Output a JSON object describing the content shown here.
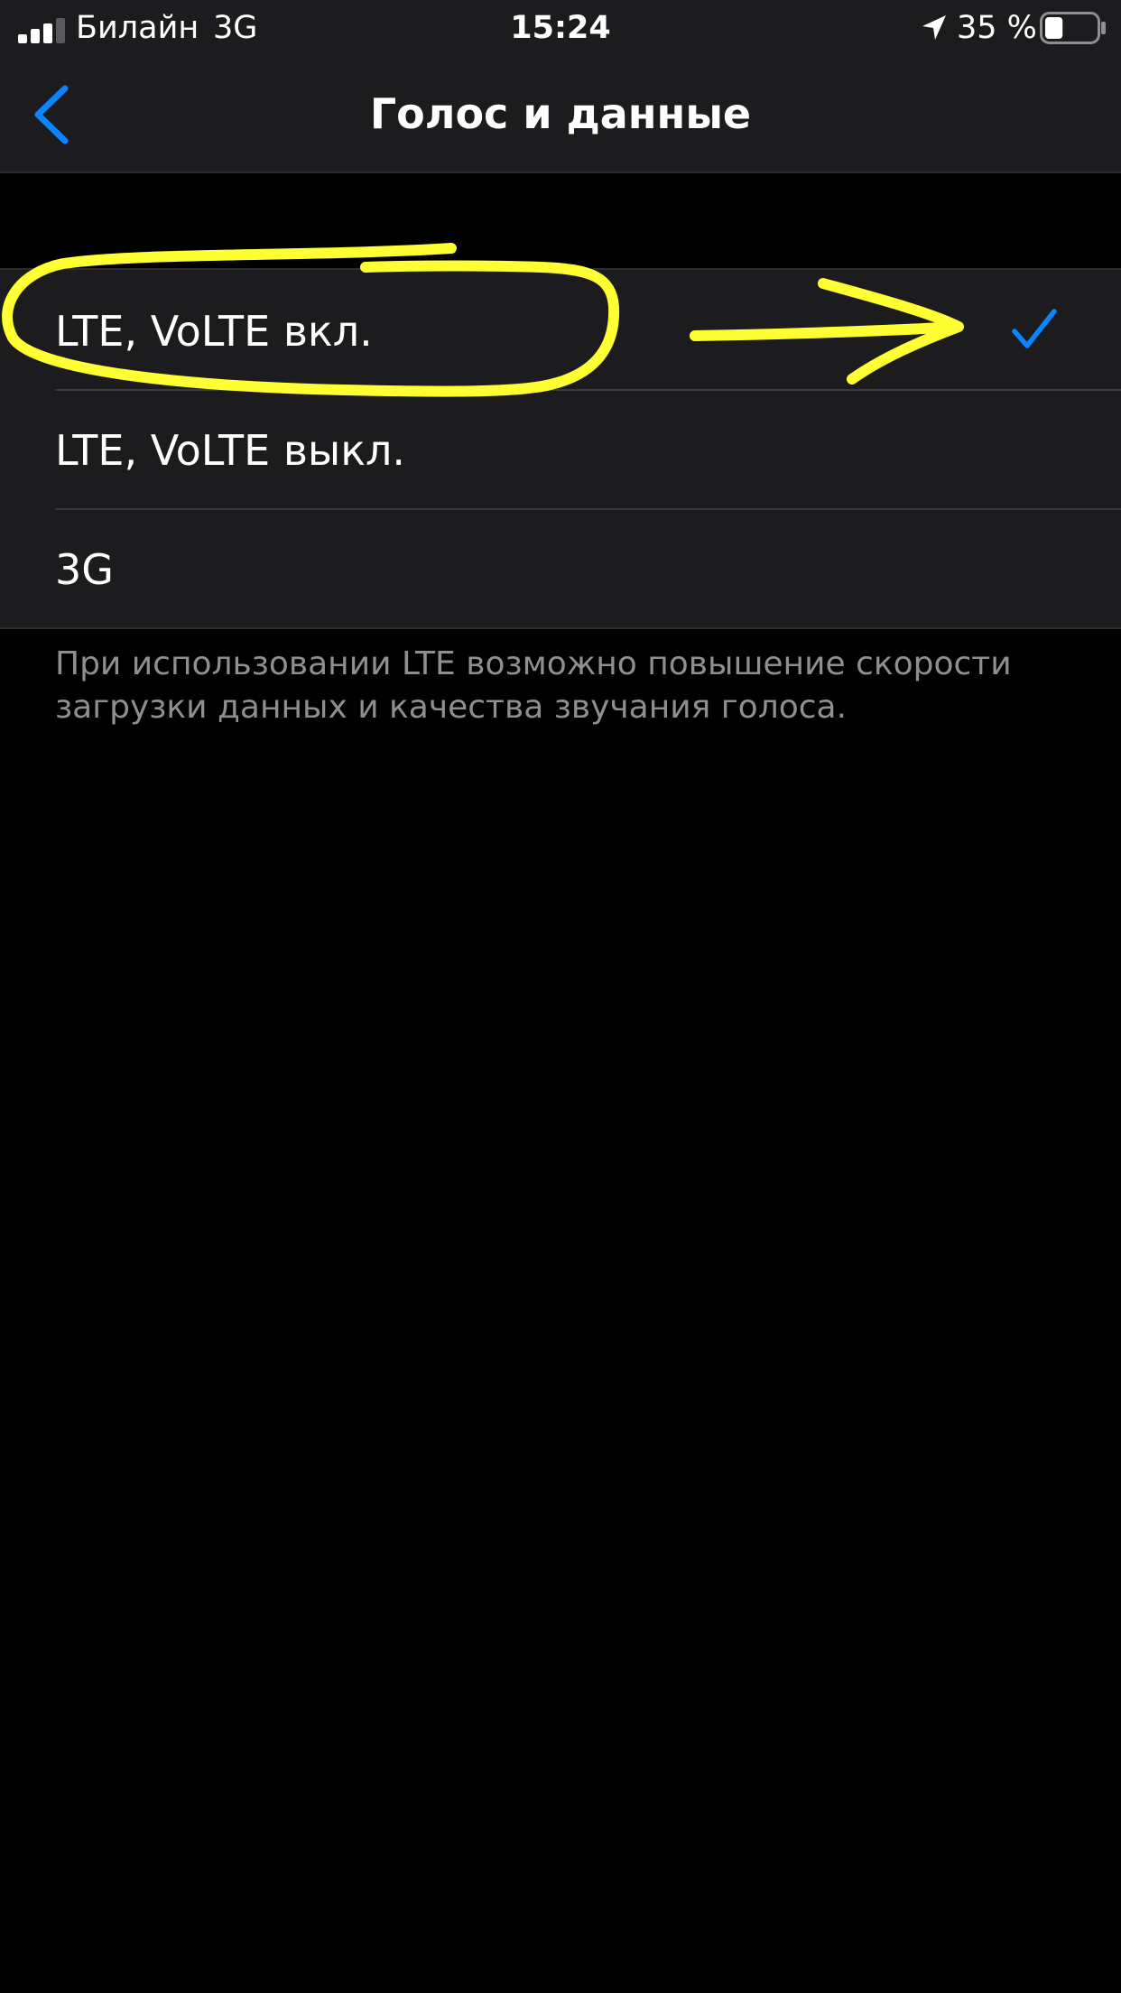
{
  "status_bar": {
    "carrier": "Билайн",
    "network": "3G",
    "time": "15:24",
    "battery_percent": "35 %",
    "battery_level": 0.35,
    "signal_bars": 3,
    "icons": [
      "signal-icon",
      "location-arrow-icon",
      "battery-icon"
    ]
  },
  "nav": {
    "title": "Голос и данные",
    "back_icon": "chevron-left-icon"
  },
  "options": [
    {
      "label": "LTE, VoLTE вкл.",
      "selected": true
    },
    {
      "label": "LTE, VoLTE выкл.",
      "selected": false
    },
    {
      "label": "3G",
      "selected": false
    }
  ],
  "footer": {
    "text": "При использовании LTE возможно повышение скорости загрузки данных и качества звучания голоса."
  },
  "colors": {
    "accent": "#0a84ff",
    "annotation": "#ffff33",
    "background": "#000000",
    "cell_background": "#1c1c1e",
    "secondary_text": "#8e8e93"
  }
}
